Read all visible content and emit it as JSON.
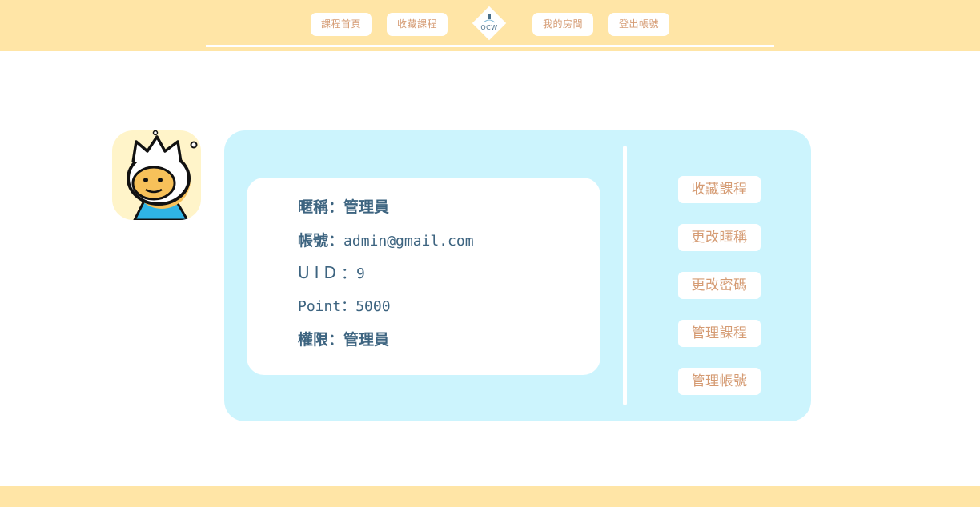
{
  "nav": {
    "items": [
      {
        "label": "課程首頁"
      },
      {
        "label": "收藏課程"
      },
      {
        "label": "我的房間"
      },
      {
        "label": "登出帳號"
      }
    ],
    "logo_text": "OCW"
  },
  "profile": {
    "nickname_label": "暱稱：",
    "nickname_value": "管理員",
    "account_label": "帳號：",
    "account_value": "admin@gmail.com",
    "uid_label": "UID",
    "uid_sep": "：",
    "uid_value": "9",
    "point_label": "Point：",
    "point_value": "5000",
    "role_label": "權限：",
    "role_value": "管理員"
  },
  "actions": [
    {
      "label": "收藏課程"
    },
    {
      "label": "更改暱稱"
    },
    {
      "label": "更改密碼"
    },
    {
      "label": "管理課程"
    },
    {
      "label": "管理帳號"
    }
  ],
  "colors": {
    "header_bg": "#ffe5a6",
    "card_bg": "#ccf4fd",
    "button_text": "#d59b73",
    "info_text": "#3d6480"
  }
}
